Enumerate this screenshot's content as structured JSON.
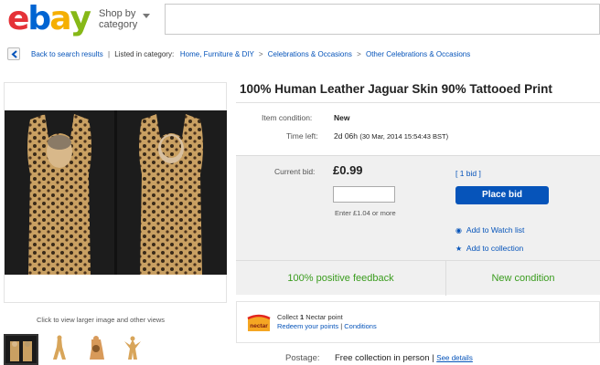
{
  "header": {
    "logo": {
      "e": "e",
      "b": "b",
      "a": "a",
      "y": "y"
    },
    "shop_by": "Shop by",
    "category": "category"
  },
  "breadcrumb": {
    "back": "Back to search results",
    "listed_in": "Listed in category:",
    "items": [
      "Home, Furniture & DIY",
      "Celebrations & Occasions",
      "Other Celebrations & Occasions"
    ],
    "separator": ">",
    "divider": "|"
  },
  "gallery": {
    "click_hint": "Click to view larger image and other views"
  },
  "item": {
    "title": "100% Human Leather Jaguar Skin 90% Tattooed Print",
    "condition_label": "Item condition:",
    "condition_value": "New",
    "time_label": "Time left:",
    "time_value": "2d 06h",
    "time_detail": "(30 Mar, 2014  15:54:43 BST)"
  },
  "bid": {
    "current_label": "Current bid:",
    "price": "£0.99",
    "bids_link": "[ 1 bid ]",
    "input_value": "",
    "enter_hint": "Enter £1.04 or more",
    "place_bid": "Place bid",
    "watch_list": "Add to Watch list",
    "collection": "Add to collection"
  },
  "feedback": {
    "positive": "100% positive feedback",
    "condition": "New condition"
  },
  "nectar": {
    "logo_text": "nectar",
    "line1_pre": "Collect ",
    "line1_num": "1",
    "line1_post": " Nectar point",
    "redeem": "Redeem your points",
    "divider": "|",
    "conditions": "Conditions"
  },
  "postage": {
    "label": "Postage:",
    "value": "Free collection in person",
    "divider": "|",
    "details": "See details"
  },
  "colors": {
    "link": "#0654ba",
    "green": "#3a9c1e",
    "button": "#0654ba"
  }
}
